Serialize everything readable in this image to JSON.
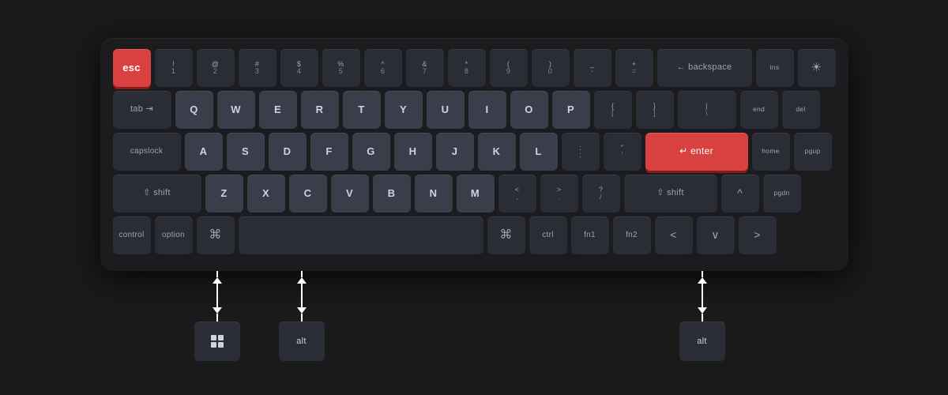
{
  "keyboard": {
    "rows": [
      {
        "keys": [
          {
            "label": "esc",
            "type": "red",
            "width": "normal"
          },
          {
            "top": "!",
            "bottom": "1",
            "type": "dark"
          },
          {
            "top": "@",
            "bottom": "2",
            "type": "dark"
          },
          {
            "top": "#",
            "bottom": "3",
            "type": "dark"
          },
          {
            "top": "$",
            "bottom": "4",
            "type": "dark"
          },
          {
            "top": "%",
            "bottom": "5",
            "type": "dark"
          },
          {
            "top": "^",
            "bottom": "6",
            "type": "dark"
          },
          {
            "top": "&",
            "bottom": "7",
            "type": "dark"
          },
          {
            "top": "*",
            "bottom": "8",
            "type": "dark"
          },
          {
            "top": "(",
            "bottom": "9",
            "type": "dark"
          },
          {
            "top": ")",
            "bottom": "0",
            "type": "dark"
          },
          {
            "top": "_",
            "bottom": "-",
            "type": "dark"
          },
          {
            "top": "+",
            "bottom": "=",
            "type": "dark"
          },
          {
            "label": "← backspace",
            "type": "dark",
            "width": "backspace"
          },
          {
            "label": "ins",
            "type": "dark"
          },
          {
            "label": "☀",
            "type": "dark"
          }
        ]
      }
    ],
    "annotation": {
      "option_label": "option",
      "cmd_label": "⌘",
      "win_label": "win",
      "alt_label": "alt",
      "ctrl_label": "ctrl",
      "fn1_label": "fn1",
      "fn2_label": "fn2"
    }
  }
}
